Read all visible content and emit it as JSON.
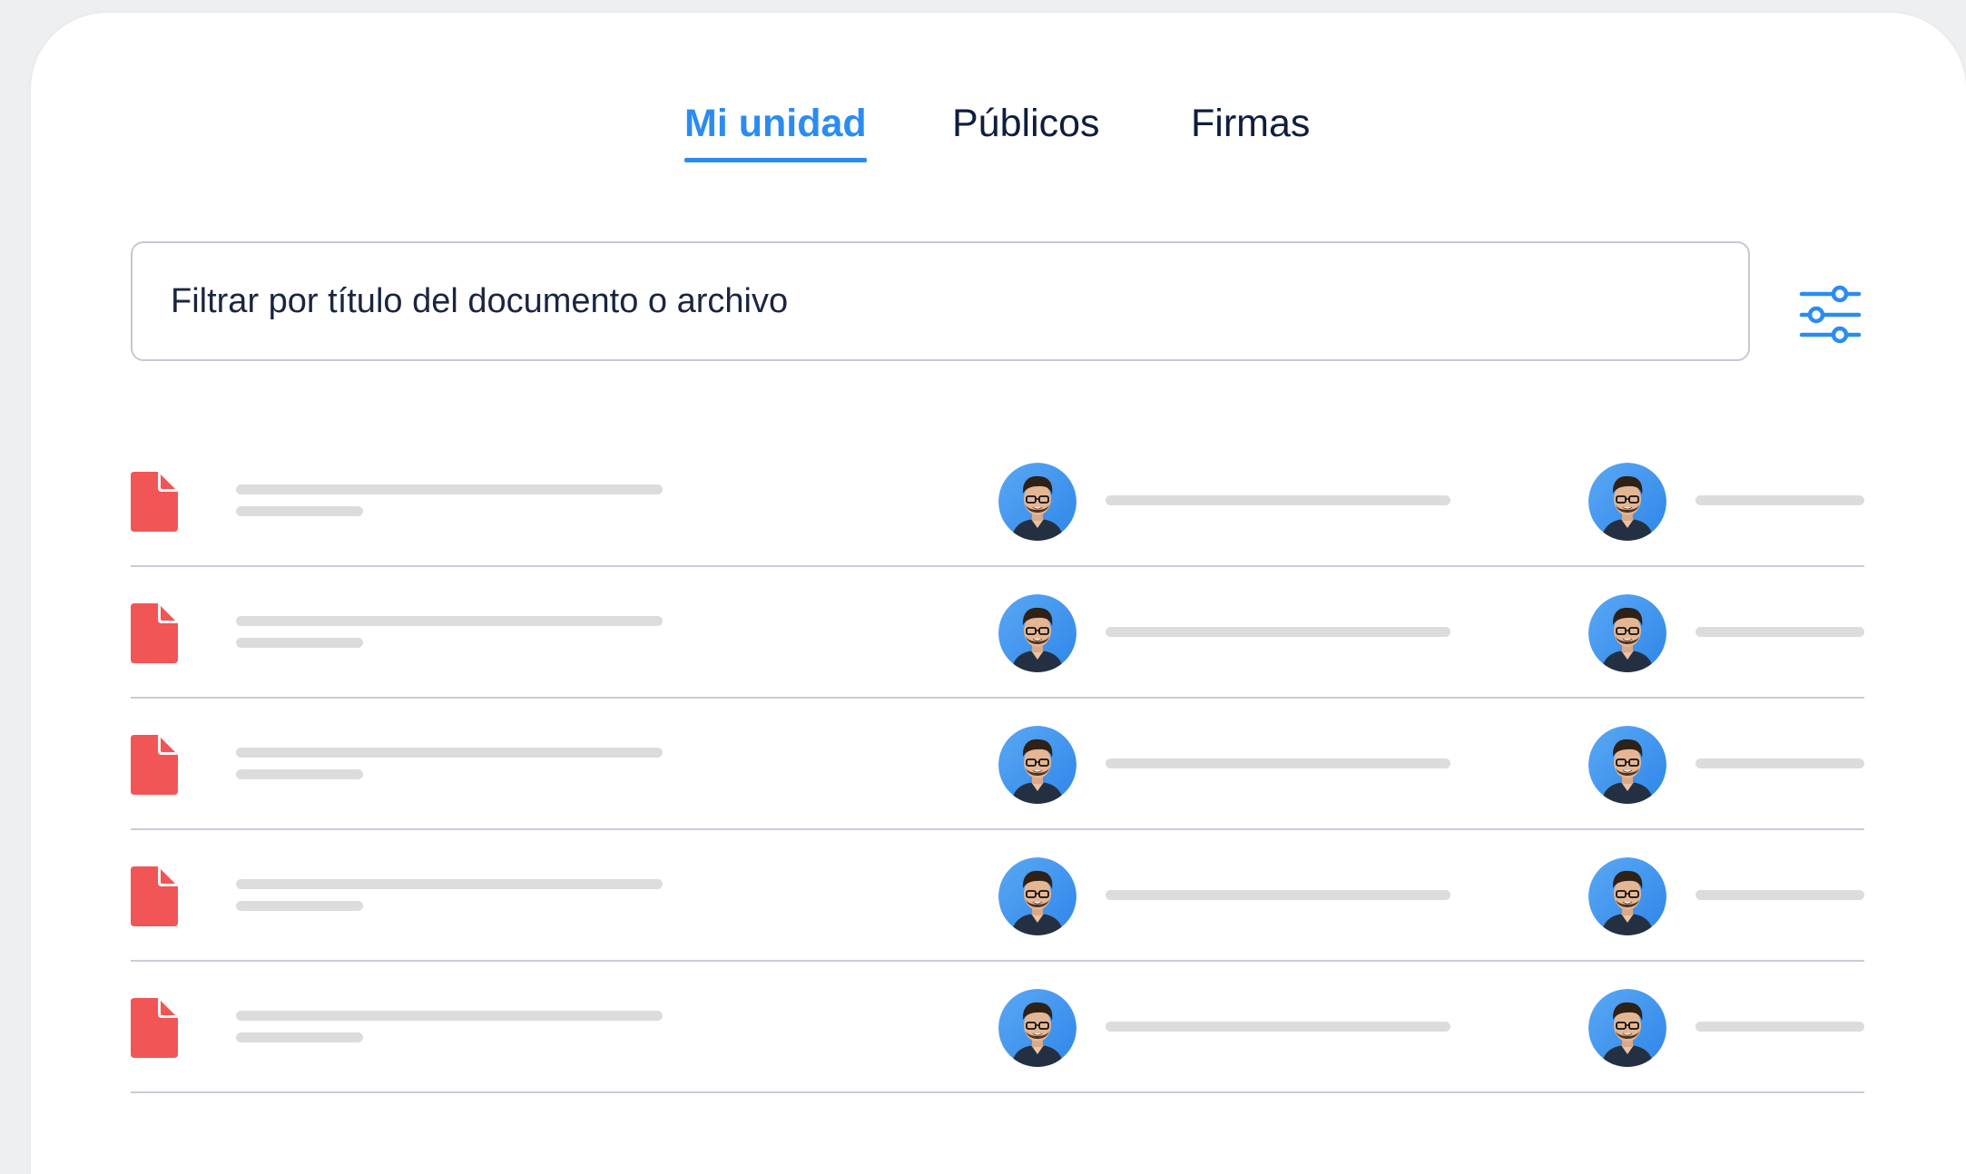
{
  "tabs": [
    {
      "label": "Mi unidad",
      "active": true
    },
    {
      "label": "Públicos",
      "active": false
    },
    {
      "label": "Firmas",
      "active": false
    }
  ],
  "search": {
    "placeholder": "Filtrar por título del documento o archivo"
  },
  "filter": {
    "icon": "sliders-icon"
  },
  "documents": {
    "row_count": 5,
    "file_icon": "document-icon",
    "file_icon_color": "#f25555"
  },
  "colors": {
    "accent": "#2b8cf0",
    "text": "#0f1e3d",
    "skeleton": "#dcdcdc",
    "divider": "#c9ccd8"
  }
}
